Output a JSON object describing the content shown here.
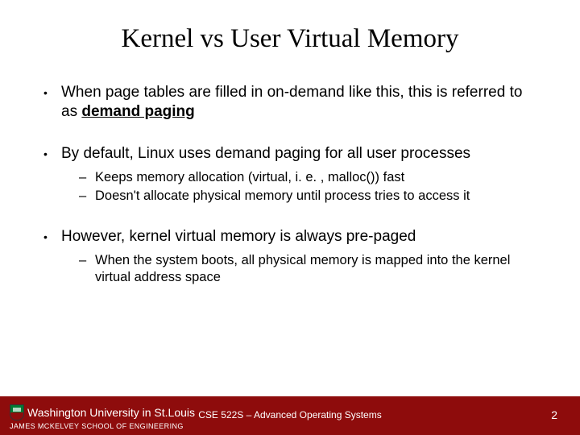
{
  "title": "Kernel vs User Virtual Memory",
  "bullets": {
    "b1_pre": "When page tables are filled in on-demand like this, this is referred to as ",
    "b1_bold": "demand paging",
    "b2": "By default, Linux uses demand paging for all user processes",
    "b2_sub1": "Keeps memory allocation (virtual, i. e. , malloc()) fast",
    "b2_sub2": "Doesn't allocate physical memory until process tries to access it",
    "b3": "However, kernel virtual memory is always pre-paged",
    "b3_sub1": "When the system boots, all physical memory is mapped into the kernel virtual address space"
  },
  "footer": {
    "university_main": "Washington University in St.Louis",
    "school": "JAMES MCKELVEY SCHOOL OF ENGINEERING",
    "course": "CSE 522S – Advanced Operating Systems",
    "page": "2"
  }
}
